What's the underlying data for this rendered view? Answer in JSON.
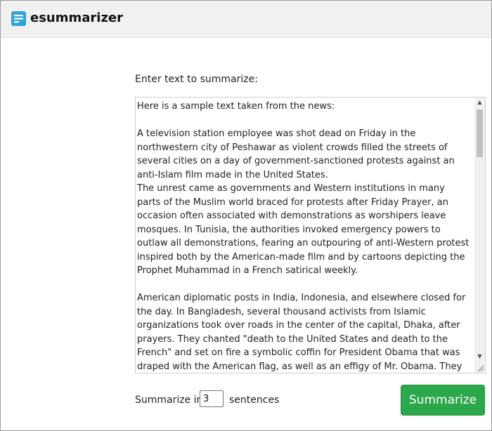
{
  "app": {
    "brand_name": "esummarizer",
    "brand_icon": "document-lines-icon",
    "accent_color": "#2ea3dc"
  },
  "form": {
    "prompt_label": "Enter text to summarize:",
    "textarea_value": "Here is a sample text taken from the news:\n\nA television station employee was shot dead on Friday in the northwestern city of Peshawar as violent crowds filled the streets of several cities on a day of government-sanctioned protests against an anti-Islam film made in the United States.\nThe unrest came as governments and Western institutions in many parts of the Muslim world braced for protests after Friday Prayer, an occasion often associated with demonstrations as worshipers leave mosques. In Tunisia, the authorities invoked emergency powers to outlaw all demonstrations, fearing an outpouring of anti-Western protest inspired both by the American-made film and by cartoons depicting the Prophet Muhammad in a French satirical weekly.\n\nAmerican diplomatic posts in India, Indonesia, and elsewhere closed for the day. In Bangladesh, several thousand activists from Islamic organizations took over roads in the center of the capital, Dhaka, after prayers. They chanted \"death to the United States and death to the French\" and set on fire a symbolic coffin for President Obama that was draped with the American flag, as well as an effigy of Mr. Obama. They also burned the American and French flags. The protesters threatened to seize the American Embassy on Saturday, but a police order banned any further",
    "summarize_in_label": "Summarize in",
    "sentence_count": "3",
    "sentences_label": "sentences",
    "submit_label": "Summarize",
    "submit_color": "#2aa84a"
  }
}
